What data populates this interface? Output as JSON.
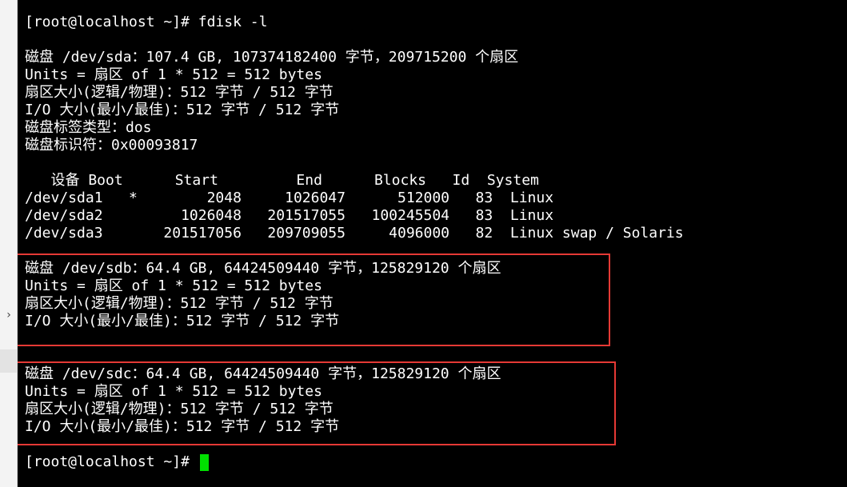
{
  "terminal": {
    "cursor_color": "#00e000",
    "highlight_color": "#e53935",
    "lines": [
      "[root@localhost ~]# fdisk -l",
      "",
      "磁盘 /dev/sda：107.4 GB, 107374182400 字节，209715200 个扇区",
      "Units = 扇区 of 1 * 512 = 512 bytes",
      "扇区大小(逻辑/物理)：512 字节 / 512 字节",
      "I/O 大小(最小/最佳)：512 字节 / 512 字节",
      "磁盘标签类型：dos",
      "磁盘标识符：0x00093817",
      "",
      "   设备 Boot      Start         End      Blocks   Id  System",
      "/dev/sda1   *        2048     1026047      512000   83  Linux",
      "/dev/sda2         1026048   201517055   100245504   83  Linux",
      "/dev/sda3       201517056   209709055     4096000   82  Linux swap / Solaris",
      "磁盘 /dev/sdb：64.4 GB, 64424509440 字节，125829120 个扇区",
      "Units = 扇区 of 1 * 512 = 512 bytes",
      "扇区大小(逻辑/物理)：512 字节 / 512 字节",
      "I/O 大小(最小/最佳)：512 字节 / 512 字节",
      "",
      "磁盘 /dev/sdc：64.4 GB, 64424509440 字节，125829120 个扇区",
      "Units = 扇区 of 1 * 512 = 512 bytes",
      "扇区大小(逻辑/物理)：512 字节 / 512 字节",
      "I/O 大小(最小/最佳)：512 字节 / 512 字节",
      "",
      "[root@localhost ~]# "
    ]
  },
  "side_panel": {
    "collapse_icon": "chevron-right-icon"
  }
}
